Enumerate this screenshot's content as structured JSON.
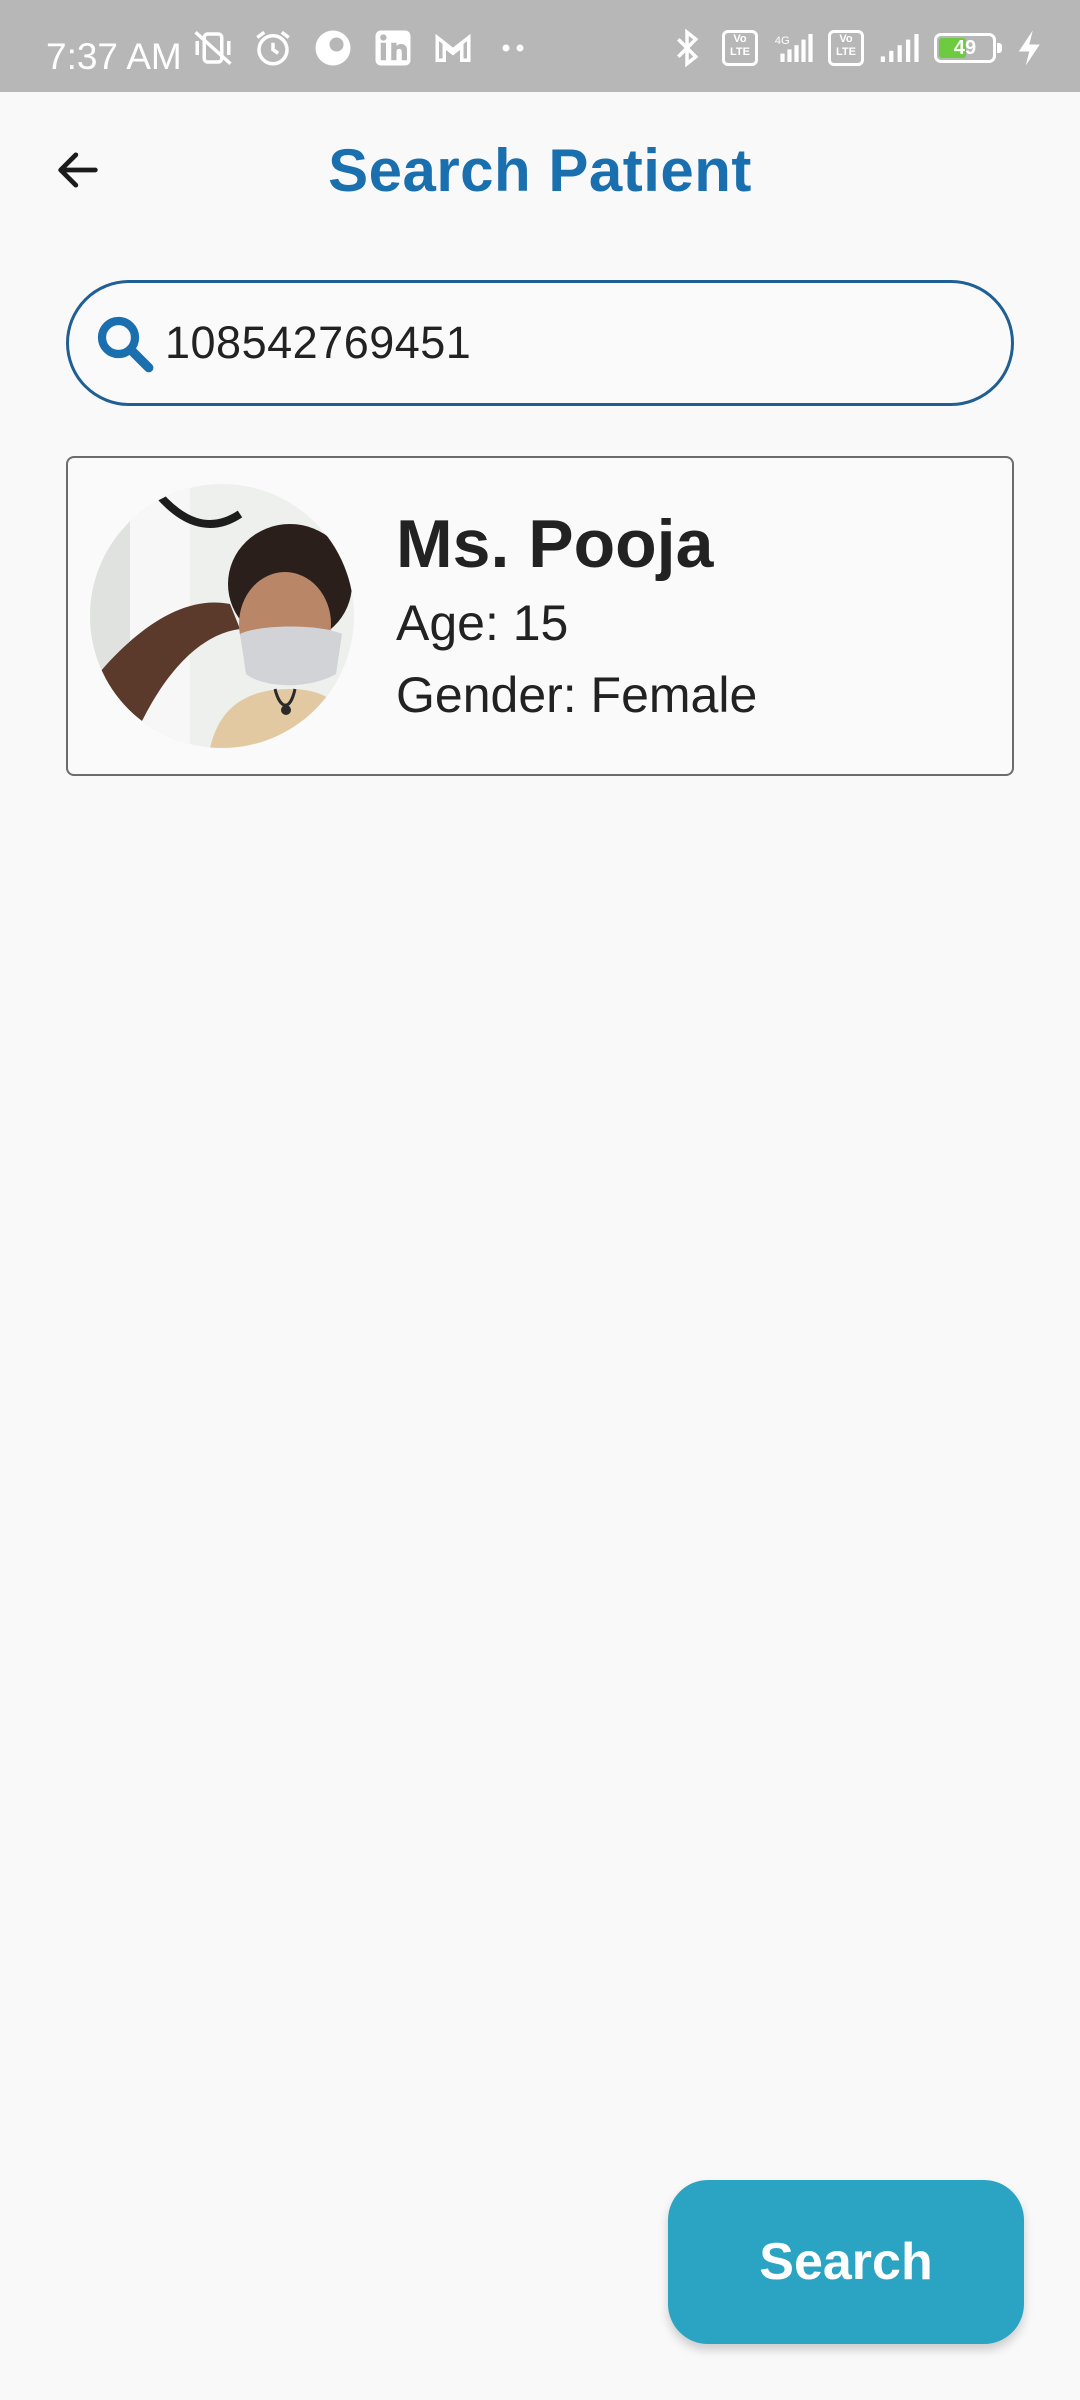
{
  "status_bar": {
    "time": "7:37 AM",
    "network_label": "4G",
    "volte_label": "Vo LTE",
    "battery_percent": "49",
    "left_icons": [
      "mute-vibrate-icon",
      "alarm-icon",
      "app-notification-icon",
      "linkedin-icon",
      "gmail-icon",
      "more-dots-icon"
    ],
    "right_icons": [
      "bluetooth-icon",
      "volte-icon",
      "signal-icon",
      "volte-icon",
      "signal-icon",
      "battery-icon",
      "charging-icon"
    ]
  },
  "header": {
    "title": "Search Patient",
    "back_icon": "arrow-left-icon"
  },
  "search": {
    "value": "108542769451",
    "placeholder": "",
    "icon": "search-icon"
  },
  "results": [
    {
      "name": "Ms. Pooja",
      "age_text": "Age: 15",
      "gender_text": "Gender: Female",
      "avatar": "patient-photo"
    }
  ],
  "actions": {
    "search_label": "Search"
  },
  "colors": {
    "title": "#1a6fae",
    "search_border": "#1f5f93",
    "button": "#2aa4c2",
    "status_bar": "#b7b7b7",
    "background": "#f9f9f9"
  }
}
